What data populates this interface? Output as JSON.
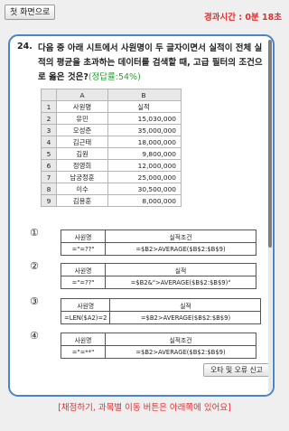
{
  "header": {
    "home_button_label": "첫 화면으로",
    "timer_text": "경과시간 : 0분 18초"
  },
  "question": {
    "number": "24.",
    "text": "다음 중 아래 시트에서 사원명이 두 글자이면서 실적이 전체 실적의 평균을 초과하는 데이터를 검색할 때, 고급 필터의 조건으로 옳은 것은?",
    "rate": "(정답률:54%)"
  },
  "sheet": {
    "col_headers": [
      "A",
      "B"
    ],
    "rows": [
      {
        "n": "1",
        "a": "사원명",
        "b": "실적"
      },
      {
        "n": "2",
        "a": "유민",
        "b": "15,030,000"
      },
      {
        "n": "3",
        "a": "오성준",
        "b": "35,000,000"
      },
      {
        "n": "4",
        "a": "김근태",
        "b": "18,000,000"
      },
      {
        "n": "5",
        "a": "김원",
        "b": "9,800,000"
      },
      {
        "n": "6",
        "a": "정영희",
        "b": "12,000,000"
      },
      {
        "n": "7",
        "a": "남궁정훈",
        "b": "25,000,000"
      },
      {
        "n": "8",
        "a": "이수",
        "b": "30,500,000"
      },
      {
        "n": "9",
        "a": "김용훈",
        "b": "8,000,000"
      }
    ]
  },
  "options": [
    {
      "mark": "①",
      "h1": "사원명",
      "h2": "실적조건",
      "v1": "=\"=??\"",
      "v2": "=$B2>AVERAGE($B$2:$B$9)"
    },
    {
      "mark": "②",
      "h1": "사원명",
      "h2": "실적",
      "v1": "=\"=??\"",
      "v2": "=$B2&\">AVERAGE($B$2:$B$9)\""
    },
    {
      "mark": "③",
      "h1": "사원명",
      "h2": "실적",
      "v1": "=LEN($A2)=2",
      "v2": "=$B2>AVERAGE($B$2:$B$9)"
    },
    {
      "mark": "④",
      "h1": "사원명",
      "h2": "실적조건",
      "v1": "=\"=**\"",
      "v2": "=$B2>AVERAGE($B$2:$B$9)"
    }
  ],
  "report_button_label": "오타 및 오류 신고",
  "footer_notice": "[채점하기, 과목별 이동 버튼은 아래쪽에 있어요]"
}
